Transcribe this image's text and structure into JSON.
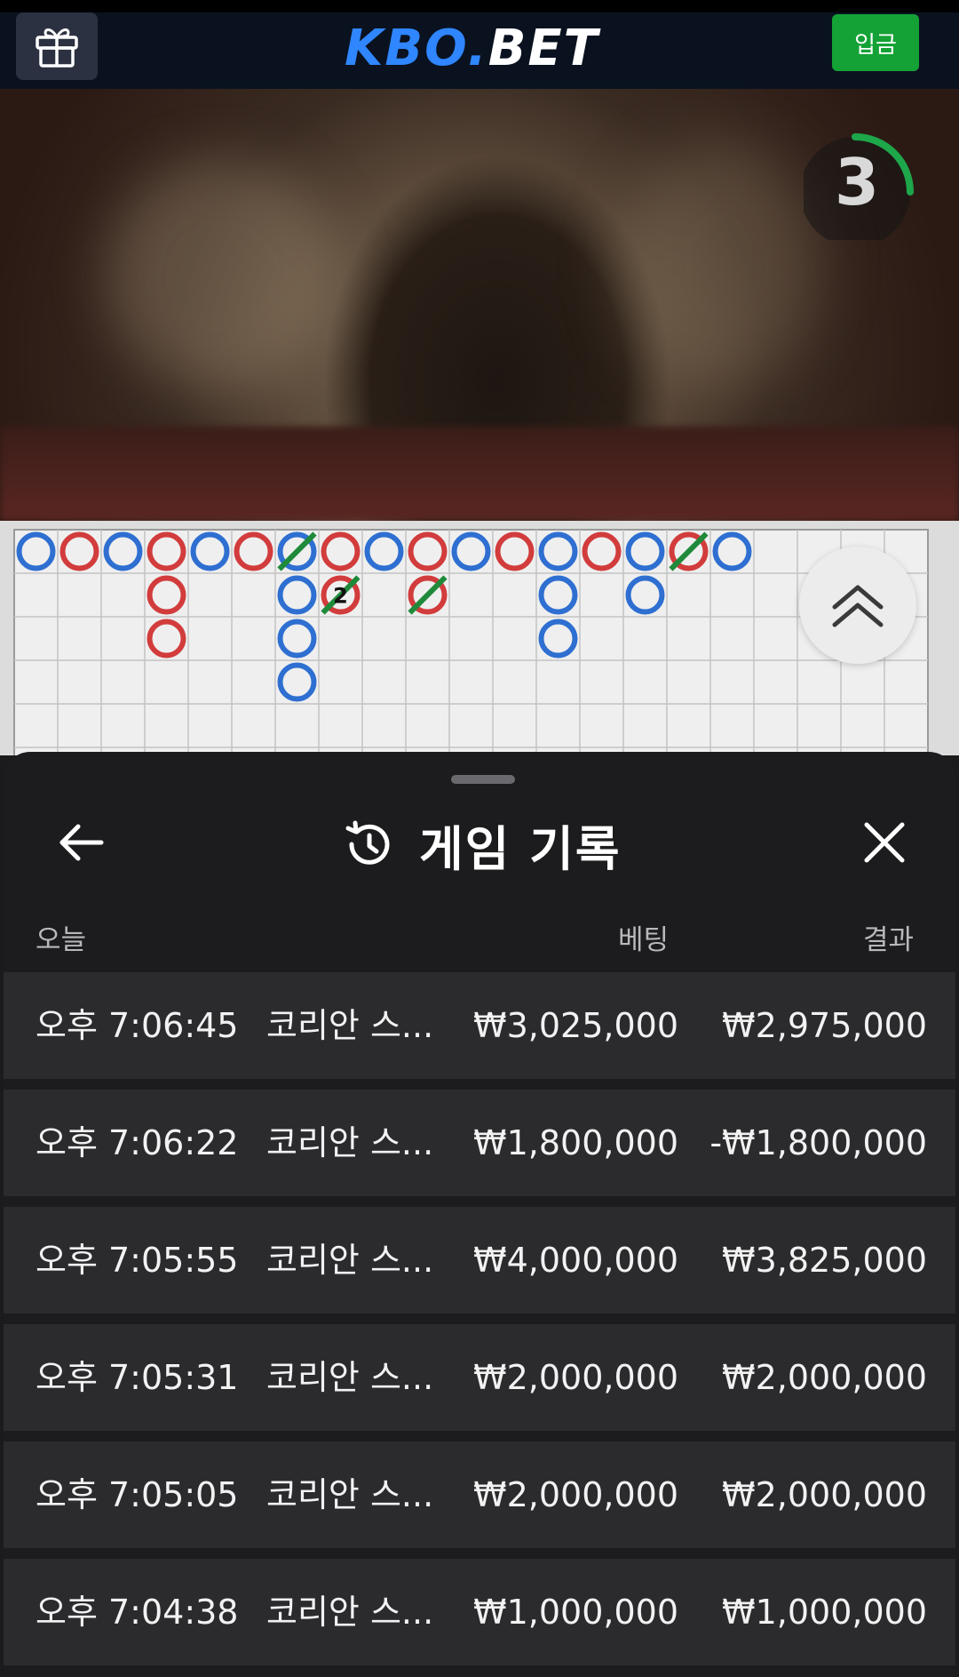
{
  "header": {
    "logo_kbo": "KBO",
    "logo_dot": ".",
    "logo_bet": "BET",
    "deposit_label": "입금"
  },
  "video": {
    "countdown": "3"
  },
  "history": {
    "title": "게임 기록",
    "columns": {
      "today": "오늘",
      "bet": "베팅",
      "result": "결과"
    },
    "rows": [
      {
        "time": "오후 7:06:45",
        "game": "코리안 스...",
        "bet": "₩3,025,000",
        "result": "₩2,975,000"
      },
      {
        "time": "오후 7:06:22",
        "game": "코리안 스...",
        "bet": "₩1,800,000",
        "result": "-₩1,800,000"
      },
      {
        "time": "오후 7:05:55",
        "game": "코리안 스...",
        "bet": "₩4,000,000",
        "result": "₩3,825,000"
      },
      {
        "time": "오후 7:05:31",
        "game": "코리안 스...",
        "bet": "₩2,000,000",
        "result": "₩2,000,000"
      },
      {
        "time": "오후 7:05:05",
        "game": "코리안 스...",
        "bet": "₩2,000,000",
        "result": "₩2,000,000"
      },
      {
        "time": "오후 7:04:38",
        "game": "코리안 스...",
        "bet": "₩1,000,000",
        "result": "₩1,000,000"
      }
    ]
  },
  "colors": {
    "banker": "#d23c3c",
    "player": "#2e6fd1",
    "tie": "#1f8a3a",
    "accent_green": "#14a236",
    "logo_blue": "#2f86ff"
  }
}
